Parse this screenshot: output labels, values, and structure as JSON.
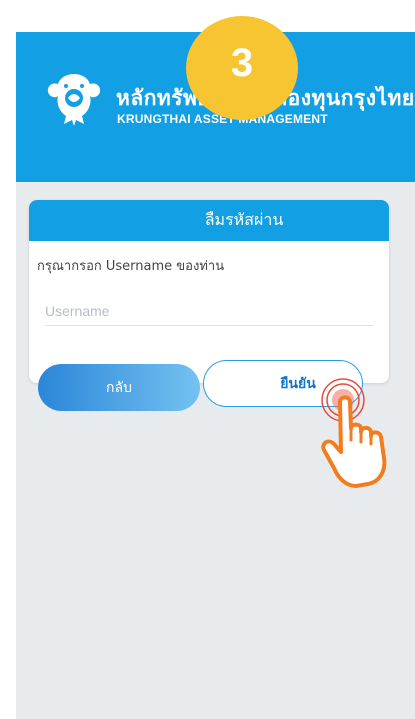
{
  "step": {
    "number": "3",
    "color": "#f7c531"
  },
  "header": {
    "brand_th": "หลักทรัพย์จัดการกองทุนกรุงไทย",
    "brand_en": "KRUNGTHAI ASSET MANAGEMENT",
    "color": "#139fe4"
  },
  "card": {
    "title": "ลืมรหัสผ่าน",
    "instruction": "กรุณากรอก Username ของท่าน",
    "username_placeholder": "Username",
    "username_value": ""
  },
  "buttons": {
    "back_label": "กลับ",
    "confirm_label": "ยืนยัน"
  },
  "icons": {
    "logo": "krungthai-garuda-logo-icon",
    "pointer": "tap-hand-icon"
  }
}
